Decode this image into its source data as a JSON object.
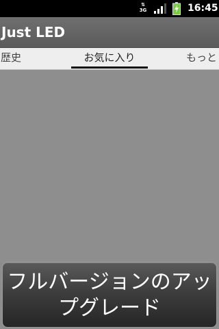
{
  "status_bar": {
    "network_type": "3G",
    "time": "16:45"
  },
  "app": {
    "title": "Just LED"
  },
  "tabs": [
    {
      "label": "歴史",
      "selected": false
    },
    {
      "label": "お気に入り",
      "selected": true
    },
    {
      "label": "もっと",
      "selected": false
    }
  ],
  "upgrade": {
    "label_line1": "フルバージョンのアッ",
    "label_line2": "プグレード"
  },
  "colors": {
    "background": "#8e8e8e",
    "title_bar": "#666666",
    "tab_strip": "#eeeeee",
    "tab_indicator": "#111111",
    "button": "#3e3e3e",
    "battery_fill": "#7ac943"
  },
  "icons": {
    "network": "network-3g-icon",
    "signal": "signal-strength-icon",
    "battery": "battery-charging-icon"
  }
}
